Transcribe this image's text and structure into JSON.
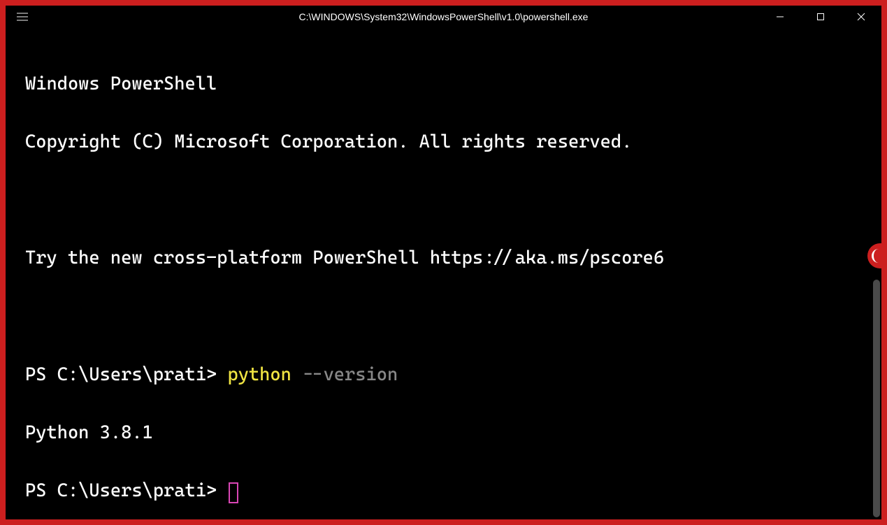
{
  "window": {
    "title": "C:\\WINDOWS\\System32\\WindowsPowerShell\\v1.0\\powershell.exe"
  },
  "terminal": {
    "banner_line1": "Windows PowerShell",
    "banner_line2": "Copyright (C) Microsoft Corporation. All rights reserved.",
    "banner_line3": "Try the new cross-platform PowerShell https://aka.ms/pscore6",
    "prompt1": "PS C:\\Users\\prati> ",
    "command_part1": "python",
    "command_part2": " --version",
    "output1": "Python 3.8.1",
    "prompt2": "PS C:\\Users\\prati> "
  },
  "controls": {
    "minimize": "minimize",
    "maximize": "maximize",
    "close": "close",
    "menu": "menu"
  }
}
